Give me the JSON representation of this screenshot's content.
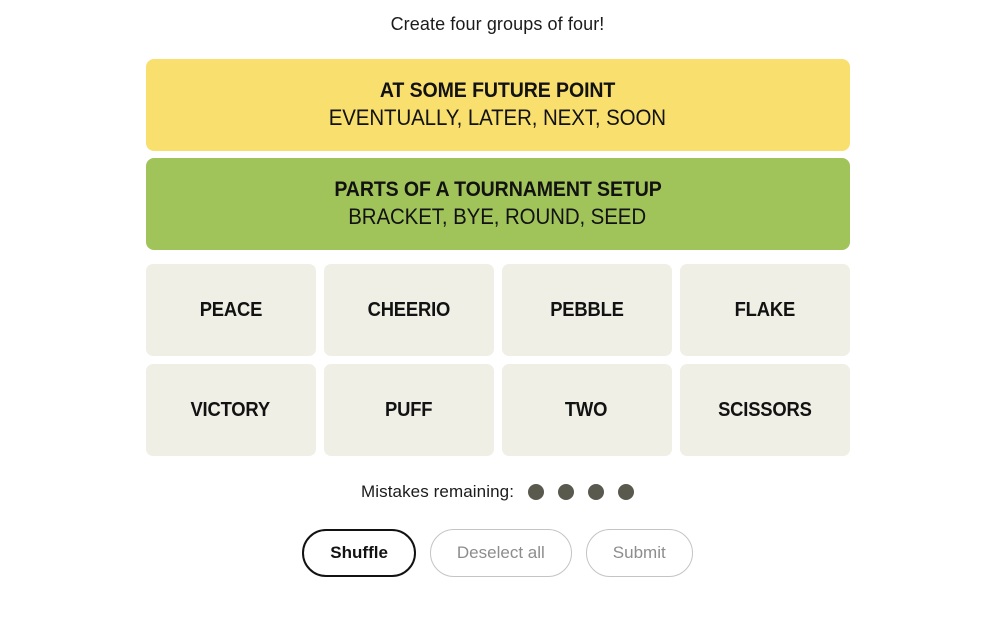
{
  "page": {
    "background_color": "#ffffff",
    "instruction": "Create four groups of four!"
  },
  "solved_groups": [
    {
      "title": "AT SOME FUTURE POINT",
      "members": "EVENTUALLY, LATER, NEXT, SOON",
      "color": "#f9df6d",
      "difficulty": "yellow"
    },
    {
      "title": "PARTS OF A TOURNAMENT SETUP",
      "members": "BRACKET, BYE, ROUND, SEED",
      "color": "#a0c35a",
      "difficulty": "green"
    }
  ],
  "tiles": [
    {
      "label": "PEACE",
      "selected": false
    },
    {
      "label": "CHEERIO",
      "selected": false
    },
    {
      "label": "PEBBLE",
      "selected": false
    },
    {
      "label": "FLAKE",
      "selected": false
    },
    {
      "label": "VICTORY",
      "selected": false
    },
    {
      "label": "PUFF",
      "selected": false
    },
    {
      "label": "TWO",
      "selected": false
    },
    {
      "label": "SCISSORS",
      "selected": false
    }
  ],
  "tile_style": {
    "background_color": "#efefe6",
    "text_color": "#121212"
  },
  "mistakes": {
    "label": "Mistakes remaining:",
    "remaining": 4,
    "dot_color": "#5a594e"
  },
  "actions": [
    {
      "label": "Shuffle",
      "state": "enabled"
    },
    {
      "label": "Deselect all",
      "state": "disabled"
    },
    {
      "label": "Submit",
      "state": "disabled"
    }
  ]
}
